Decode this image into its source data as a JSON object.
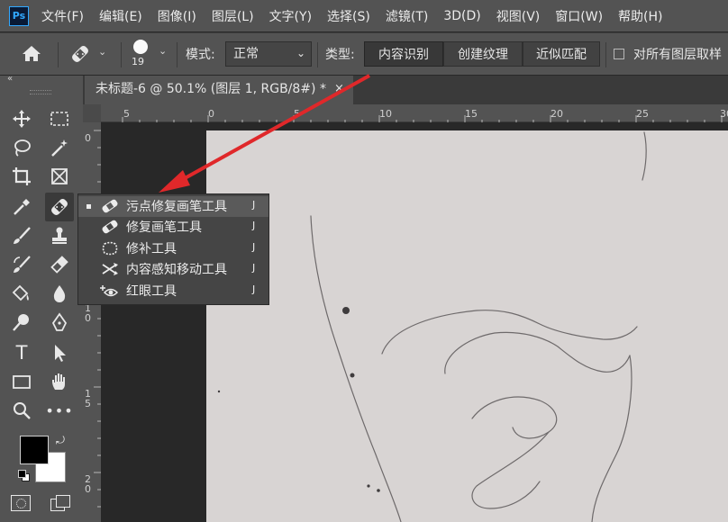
{
  "app": {
    "logo": "Ps"
  },
  "menu": [
    "文件(F)",
    "编辑(E)",
    "图像(I)",
    "图层(L)",
    "文字(Y)",
    "选择(S)",
    "滤镜(T)",
    "3D(D)",
    "视图(V)",
    "窗口(W)",
    "帮助(H)"
  ],
  "options": {
    "brush_size": "19",
    "mode_label": "模式:",
    "mode_value": "正常",
    "type_label": "类型:",
    "type_buttons": [
      "内容识别",
      "创建纹理",
      "近似匹配"
    ],
    "sample_all_label": "对所有图层取样"
  },
  "document": {
    "tab_title": "未标题-6 @ 50.1% (图层 1, RGB/8#) *",
    "close_glyph": "×"
  },
  "ruler": {
    "h_labels": [
      "5",
      "0",
      "5",
      "10",
      "15",
      "20",
      "25",
      "30"
    ],
    "v_labels": [
      "0",
      "5",
      "1\n0",
      "1\n5",
      "2\n0"
    ]
  },
  "tool_flyout": {
    "items": [
      {
        "label": "污点修复画笔工具",
        "shortcut": "J",
        "icon": "spot-healing-brush-icon",
        "selected": true
      },
      {
        "label": "修复画笔工具",
        "shortcut": "J",
        "icon": "healing-brush-icon",
        "selected": false
      },
      {
        "label": "修补工具",
        "shortcut": "J",
        "icon": "patch-icon",
        "selected": false
      },
      {
        "label": "内容感知移动工具",
        "shortcut": "J",
        "icon": "content-aware-move-icon",
        "selected": false
      },
      {
        "label": "红眼工具",
        "shortcut": "J",
        "icon": "red-eye-icon",
        "selected": false
      }
    ]
  },
  "colors": {
    "accent": "#31a8ff",
    "arrow": "#e0282a",
    "canvas": "#d8d4d3"
  }
}
